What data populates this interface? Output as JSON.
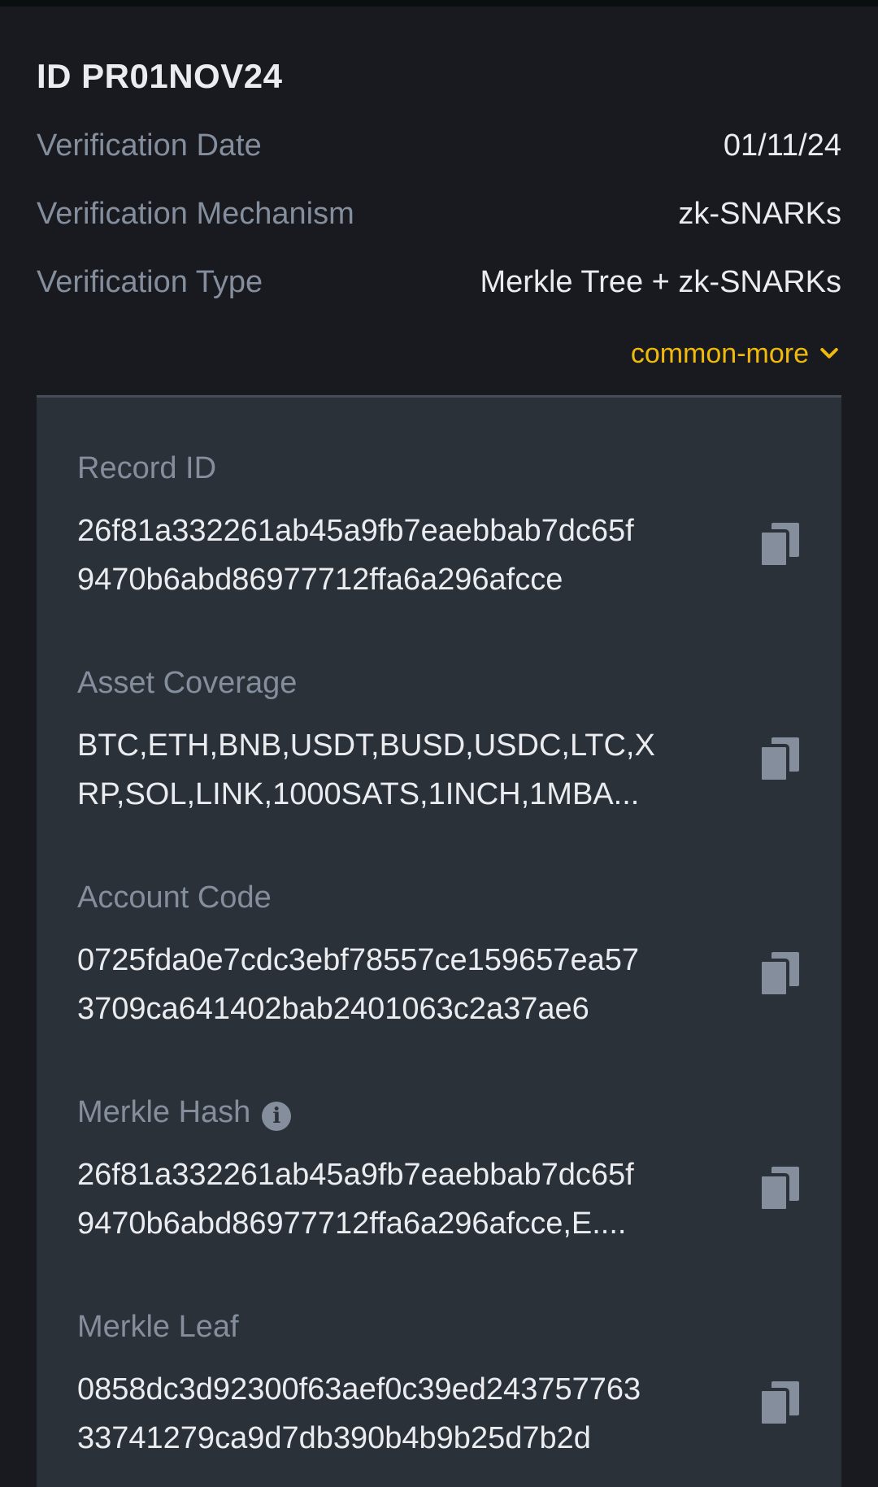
{
  "header": {
    "title": "ID PR01NOV24"
  },
  "summary": [
    {
      "label": "Verification Date",
      "value": "01/11/24"
    },
    {
      "label": "Verification Mechanism",
      "value": "zk-SNARKs"
    },
    {
      "label": "Verification Type",
      "value": "Merkle Tree + zk-SNARKs"
    }
  ],
  "more": {
    "label": "common-more",
    "icon": "chevron-down-icon",
    "color": "#f0b90b"
  },
  "details": [
    {
      "label": "Record ID",
      "value": "26f81a332261ab45a9fb7eaebbab7dc65f\n9470b6abd86977712ffa6a296afcce",
      "copy_icon": "copy-icon"
    },
    {
      "label": "Asset Coverage",
      "value": "BTC,ETH,BNB,USDT,BUSD,USDC,LTC,X\nRP,SOL,LINK,1000SATS,1INCH,1MBA...",
      "copy_icon": "copy-icon"
    },
    {
      "label": "Account Code",
      "value": "0725fda0e7cdc3ebf78557ce159657ea57\n3709ca641402bab2401063c2a37ae6",
      "copy_icon": "copy-icon"
    },
    {
      "label": "Merkle Hash",
      "value": "26f81a332261ab45a9fb7eaebbab7dc65f\n9470b6abd86977712ffa6a296afcce,E....",
      "copy_icon": "copy-icon",
      "info_icon": "info-icon"
    },
    {
      "label": "Merkle Leaf",
      "value": "0858dc3d92300f63aef0c39ed243757763\n33741279ca9d7db390b4b9b25d7b2d",
      "copy_icon": "copy-icon"
    }
  ],
  "colors": {
    "background": "#181a20",
    "panel": "#2b3139",
    "label": "#848e9c",
    "value": "#eaecef",
    "accent": "#f0b90b"
  }
}
